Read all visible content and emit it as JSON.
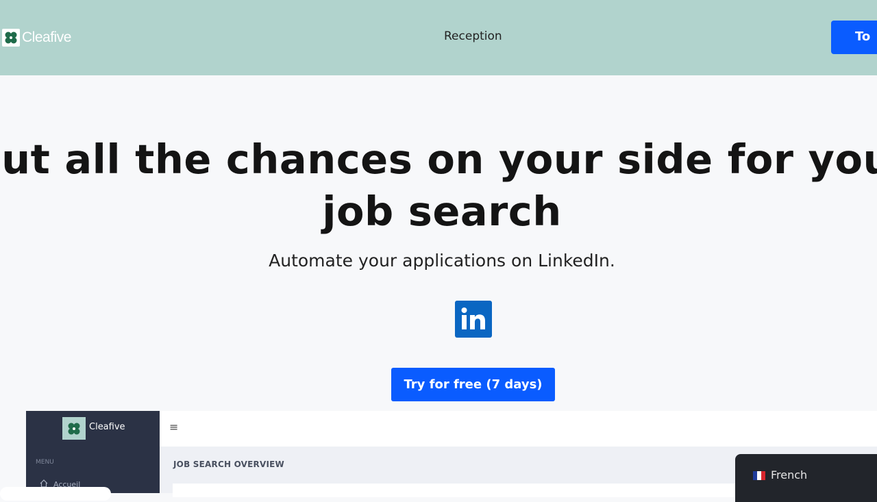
{
  "brand": {
    "name": "Cleafive"
  },
  "nav": {
    "reception": "Reception",
    "cta": "To"
  },
  "hero": {
    "title_line1": "Put all the chances on your side for your",
    "title_line2": "job search",
    "subtitle": "Automate your applications on LinkedIn.",
    "linkedin_badge": "in",
    "try_button": "Try for free (7 days)"
  },
  "dashboard": {
    "brand": "Cleafive",
    "menu_label": "MENU",
    "menu_item_home": "Accueil",
    "overview_title": "JOB SEARCH OVERVIEW",
    "hamburger": "≡"
  },
  "language": {
    "label": "French"
  },
  "colors": {
    "header_bg": "#b1d3cd",
    "primary": "#0a5cff",
    "linkedin": "#0a66c2",
    "sidebar": "#2b3245",
    "lang_bg": "#22252b"
  },
  "icons": [
    "clover-logo-icon",
    "linkedin-icon",
    "home-icon",
    "menu-icon",
    "french-flag-icon"
  ]
}
